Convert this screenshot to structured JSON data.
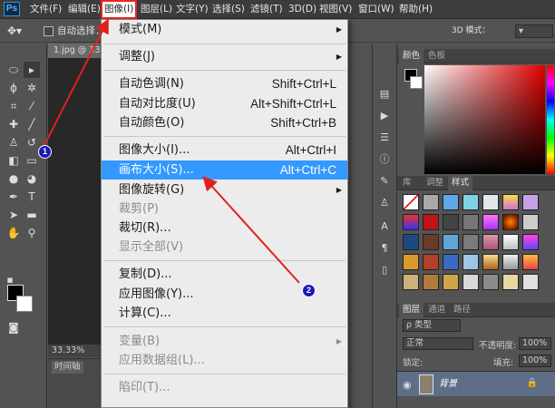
{
  "app": {
    "logo": "Ps"
  },
  "menubar": {
    "items": [
      "文件(F)",
      "编辑(E)",
      "图像(I)",
      "图层(L)",
      "文字(Y)",
      "选择(S)",
      "滤镜(T)",
      "3D(D)",
      "视图(V)",
      "窗口(W)",
      "帮助(H)"
    ]
  },
  "options": {
    "auto_select": "自动选择：",
    "mode_3d": "3D 模式："
  },
  "document": {
    "tab": "1.jpg @ 33.3",
    "zoom": "33.33%",
    "timeline_tab": "时间轴"
  },
  "image_menu": {
    "items": [
      {
        "label": "模式(M)",
        "shortcut": "",
        "submenu": true,
        "disabled": false
      },
      {
        "label": "调整(J)",
        "shortcut": "",
        "submenu": true,
        "disabled": false
      },
      {
        "label": "自动色调(N)",
        "shortcut": "Shift+Ctrl+L",
        "submenu": false,
        "disabled": false
      },
      {
        "label": "自动对比度(U)",
        "shortcut": "Alt+Shift+Ctrl+L",
        "submenu": false,
        "disabled": false
      },
      {
        "label": "自动颜色(O)",
        "shortcut": "Shift+Ctrl+B",
        "submenu": false,
        "disabled": false
      },
      {
        "label": "图像大小(I)...",
        "shortcut": "Alt+Ctrl+I",
        "submenu": false,
        "disabled": false
      },
      {
        "label": "画布大小(S)...",
        "shortcut": "Alt+Ctrl+C",
        "submenu": false,
        "disabled": false,
        "highlighted": true
      },
      {
        "label": "图像旋转(G)",
        "shortcut": "",
        "submenu": true,
        "disabled": false
      },
      {
        "label": "裁剪(P)",
        "shortcut": "",
        "submenu": false,
        "disabled": true
      },
      {
        "label": "裁切(R)...",
        "shortcut": "",
        "submenu": false,
        "disabled": false
      },
      {
        "label": "显示全部(V)",
        "shortcut": "",
        "submenu": false,
        "disabled": true
      },
      {
        "label": "复制(D)...",
        "shortcut": "",
        "submenu": false,
        "disabled": false
      },
      {
        "label": "应用图像(Y)...",
        "shortcut": "",
        "submenu": false,
        "disabled": false
      },
      {
        "label": "计算(C)...",
        "shortcut": "",
        "submenu": false,
        "disabled": false
      },
      {
        "label": "变量(B)",
        "shortcut": "",
        "submenu": true,
        "disabled": true
      },
      {
        "label": "应用数据组(L)...",
        "shortcut": "",
        "submenu": false,
        "disabled": true
      },
      {
        "label": "陷印(T)...",
        "shortcut": "",
        "submenu": false,
        "disabled": true
      }
    ]
  },
  "panels": {
    "color_tabs": [
      "颜色",
      "色板"
    ],
    "style_tabs": [
      "库",
      "调整",
      "样式"
    ],
    "layer_tabs": [
      "图层",
      "通道",
      "路径"
    ],
    "layer_kind": "ρ 类型",
    "blend_mode": "正常",
    "opacity_label": "不透明度:",
    "opacity_value": "100%",
    "lock_label": "锁定:",
    "fill_label": "填充:",
    "fill_value": "100%",
    "layer_name": "背景"
  },
  "annotations": {
    "badge1": "1",
    "badge2": "2"
  },
  "colors": {
    "highlight": "#3399ff",
    "annotation_arrow": "#e02020",
    "badge": "#1a1ab8"
  }
}
